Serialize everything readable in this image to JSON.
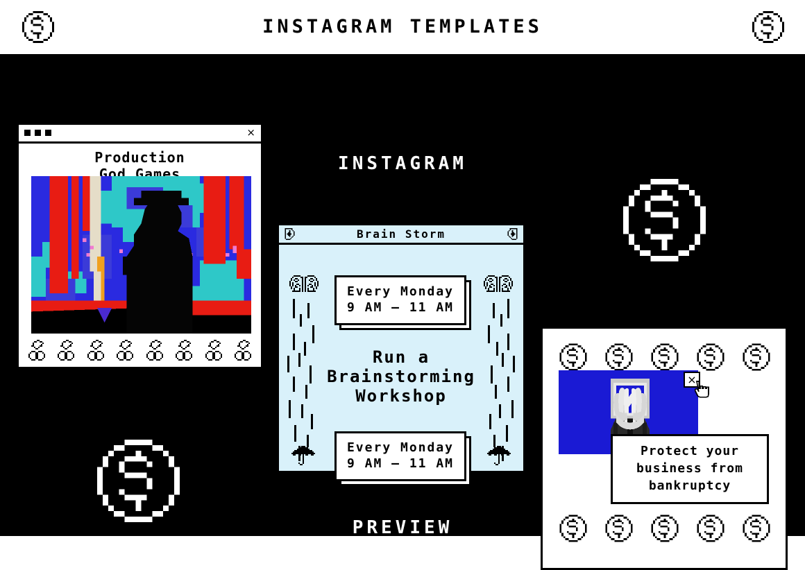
{
  "header": {
    "title": "INSTAGRAM TEMPLATES",
    "coin_icon_left": "dollar-coin-icon",
    "coin_icon_right": "dollar-coin-icon"
  },
  "canvas": {
    "background_color": "#000000",
    "label_instagram": "INSTAGRAM",
    "label_preview": "PREVIEW",
    "big_coin_icon": "dollar-coin-icon"
  },
  "panel1": {
    "window_title_dots": "window-dots",
    "close_label": "×",
    "title_line1": "Production",
    "title_line2": "God Games",
    "photo_alt": "pixelated silhouette of person in hat against red and blue pixel art",
    "cherry_icon": "cherry-icon",
    "cherry_count": 8,
    "photo_colors": {
      "red": "#e81c13",
      "blue": "#2a2ae0",
      "cyan": "#2ec8c8",
      "violet": "#5b3ad6",
      "pink": "#f07ad0",
      "cream": "#e5ddc8",
      "orange": "#f0a01e",
      "black": "#000000"
    }
  },
  "panel2": {
    "background_color": "#d9f1fa",
    "title": "Brain Storm",
    "bolt_icon": "lightning-bolt-icon",
    "brain_icon": "brain-icon",
    "umbrella_icon": "umbrella-icon",
    "schedule_top": {
      "line1": "Every Monday",
      "line2": "9 AM — 11 AM"
    },
    "schedule_bottom": {
      "line1": "Every Monday",
      "line2": "9 AM — 11 AM"
    },
    "headline_line1": "Run a",
    "headline_line2": "Brainstorming",
    "headline_line3": "Workshop"
  },
  "panel3": {
    "coins_top_count": 5,
    "coins_bottom_count": 5,
    "coin_icon": "dollar-coin-icon",
    "blue_color": "#1a1ad4",
    "close_label": "×",
    "cursor_icon": "hand-pointer-cursor-icon",
    "figure_alt": "businessman in suit with hands covering framed window instead of head",
    "message_line1": "Protect your",
    "message_line2": "business from",
    "message_line3": "bankruptcy"
  }
}
